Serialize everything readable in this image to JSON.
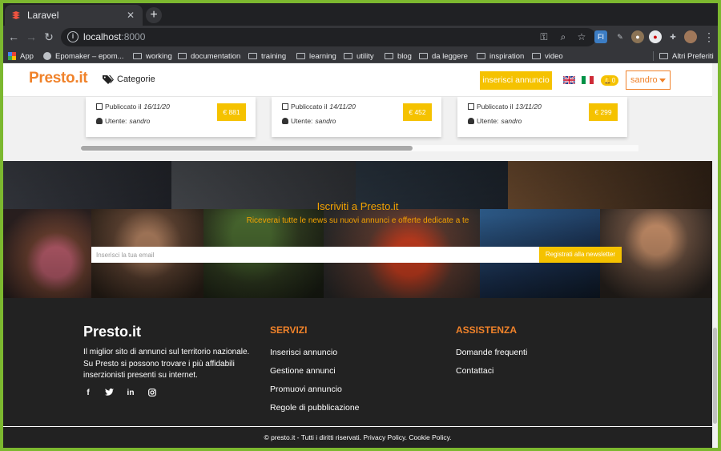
{
  "browser": {
    "tab_title": "Laravel",
    "url_host": "localhost",
    "url_port": ":8000",
    "bookmarks": [
      {
        "label": "App",
        "icon": "apps-grid-icon"
      },
      {
        "label": "Epomaker – epom...",
        "icon": "globe-icon"
      },
      {
        "label": "working",
        "icon": "folder-icon"
      },
      {
        "label": "documentation",
        "icon": "folder-icon"
      },
      {
        "label": "training",
        "icon": "folder-icon"
      },
      {
        "label": "learning",
        "icon": "folder-icon"
      },
      {
        "label": "utility",
        "icon": "folder-icon"
      },
      {
        "label": "blog",
        "icon": "folder-icon"
      },
      {
        "label": "da leggere",
        "icon": "folder-icon"
      },
      {
        "label": "inspiration",
        "icon": "folder-icon"
      },
      {
        "label": "video",
        "icon": "folder-icon"
      }
    ],
    "other_bookmarks": "Altri Preferiti"
  },
  "navbar": {
    "brand": "Presto.it",
    "categories": "Categorie",
    "insert_button": "inserisci annuncio",
    "notifications_count": "0",
    "user": "sandro"
  },
  "cards": [
    {
      "published_label": "Publiccato il",
      "date": "16/11/20",
      "user_label": "Utente:",
      "user": "sandro",
      "price": "€ 881"
    },
    {
      "published_label": "Publiccato il",
      "date": "14/11/20",
      "user_label": "Utente:",
      "user": "sandro",
      "price": "€ 452"
    },
    {
      "published_label": "Publiccato il",
      "date": "13/11/20",
      "user_label": "Utente:",
      "user": "sandro",
      "price": "€ 299"
    }
  ],
  "newsletter": {
    "title": "Iscriviti a Presto.it",
    "subtitle": "Riceverai tutte le news su nuovi annunci e offerte dedicate a te",
    "placeholder": "Inserisci la tua email",
    "button": "Registrati alla newsletter"
  },
  "footer": {
    "brand": "Presto.it",
    "description": "Il miglior sito di annunci sul territorio nazionale. Su Presto si possono trovare i più affidabili inserzionisti presenti su internet.",
    "social": [
      "facebook-icon",
      "twitter-icon",
      "linkedin-icon",
      "instagram-icon"
    ],
    "services_title": "SERVIZI",
    "services": [
      "Inserisci annuncio",
      "Gestione annunci",
      "Promuovi annuncio",
      "Regole di pubblicazione"
    ],
    "support_title": "ASSISTENZA",
    "support": [
      "Domande frequenti",
      "Contattaci"
    ],
    "copyright": "© presto.it - Tutti i diritti riservati. Privacy Policy. Cookie Policy."
  },
  "colors": {
    "brand_orange": "#f0822a",
    "accent_yellow": "#f5c200",
    "footer_bg": "#222222",
    "window_border": "#7cb82f"
  }
}
